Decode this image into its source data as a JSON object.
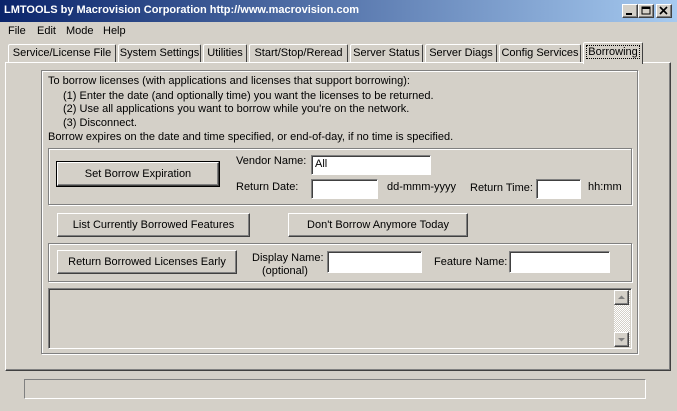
{
  "window": {
    "title": "LMTOOLS by Macrovision Corporation http://www.macrovision.com",
    "controls": {
      "minimize": "minimize-icon",
      "maximize": "maximize-icon",
      "close": "close-icon"
    }
  },
  "menu": [
    "File",
    "Edit",
    "Mode",
    "Help"
  ],
  "tabs": [
    "Service/License File",
    "System Settings",
    "Utilities",
    "Start/Stop/Reread",
    "Server Status",
    "Server Diags",
    "Config Services",
    "Borrowing"
  ],
  "active_tab": "Borrowing",
  "instructions": {
    "intro": "To borrow licenses (with applications and licenses that support borrowing):",
    "step1": "(1) Enter the date (and optionally time) you want the licenses to be returned.",
    "step2": "(2) Use all applications you want to borrow while you're on the network.",
    "step3": "(3) Disconnect.",
    "note": "Borrow expires on the date and time specified, or end-of-day, if no time is specified."
  },
  "borrow_group": {
    "set_button": "Set Borrow Expiration",
    "vendor_label": "Vendor Name:",
    "vendor_value": "All",
    "return_date_label": "Return Date:",
    "return_date_value": "",
    "date_format": "dd-mmm-yyyy",
    "return_time_label": "Return Time:",
    "return_time_value": "",
    "time_format": "hh:mm"
  },
  "actions": {
    "list_button": "List Currently Borrowed Features",
    "dont_borrow_button": "Don't Borrow Anymore Today"
  },
  "return_group": {
    "return_button": "Return Borrowed Licenses Early",
    "display_name_label": "Display Name:",
    "display_name_hint": "(optional)",
    "display_name_value": "",
    "feature_name_label": "Feature Name:",
    "feature_name_value": ""
  },
  "output": {
    "text": ""
  },
  "status": {
    "text": ""
  }
}
